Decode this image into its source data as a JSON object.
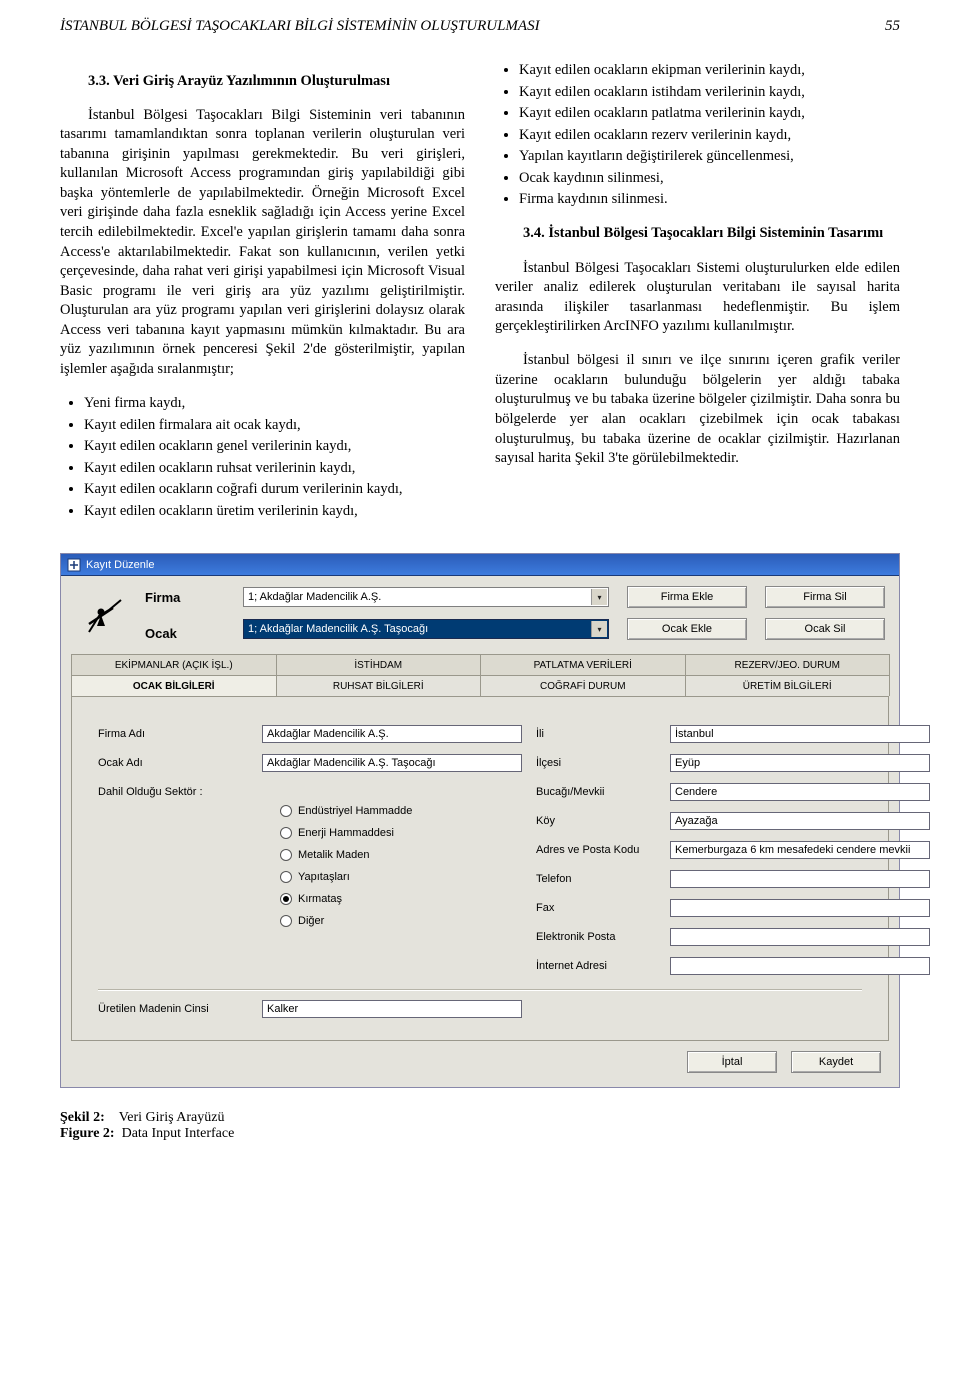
{
  "header": {
    "title": "İSTANBUL BÖLGESİ TAŞOCAKLARI BİLGİ SİSTEMİNİN OLUŞTURULMASI",
    "page_number": "55"
  },
  "left": {
    "heading": "3.3. Veri Giriş Arayüz Yazılımının Oluşturulması",
    "p1": "İstanbul Bölgesi Taşocakları Bilgi Sisteminin veri tabanının tasarımı tamamlandıktan sonra toplanan verilerin oluşturulan veri tabanına girişinin yapılması gerekmektedir. Bu veri girişleri, kullanılan Microsoft Access programından giriş yapılabildiği gibi başka yöntemlerle de yapılabilmektedir. Örneğin Microsoft Excel veri girişinde daha fazla esneklik sağladığı için Access yerine Excel tercih edilebilmektedir. Excel'e yapılan girişlerin tamamı daha sonra Access'e aktarılabilmektedir. Fakat son kullanıcının, verilen yetki çerçevesinde, daha rahat veri girişi yapabilmesi için Microsoft Visual Basic programı ile veri giriş ara yüz yazılımı geliştirilmiştir. Oluşturulan ara yüz programı yapılan veri girişlerini dolaysız olarak Access veri tabanına kayıt yapmasını mümkün kılmaktadır. Bu ara yüz yazılımının örnek penceresi Şekil 2'de gösterilmiştir, yapılan işlemler aşağıda sıralanmıştır;",
    "bullets": [
      "Yeni firma kaydı,",
      "Kayıt edilen firmalara ait ocak kaydı,",
      "Kayıt edilen ocakların genel verilerinin kaydı,",
      "Kayıt edilen ocakların ruhsat verilerinin kaydı,",
      "Kayıt edilen ocakların coğrafi durum verilerinin kaydı,",
      "Kayıt edilen ocakların üretim verilerinin kaydı,"
    ]
  },
  "right": {
    "bullets": [
      "Kayıt edilen ocakların ekipman verilerinin kaydı,",
      "Kayıt edilen ocakların istihdam verilerinin kaydı,",
      "Kayıt edilen ocakların patlatma verilerinin kaydı,",
      "Kayıt edilen ocakların rezerv verilerinin kaydı,",
      "Yapılan kayıtların değiştirilerek güncellenmesi,",
      "Ocak kaydının silinmesi,",
      "Firma kaydının silinmesi."
    ],
    "heading": "3.4. İstanbul Bölgesi Taşocakları Bilgi Sisteminin Tasarımı",
    "p1": "İstanbul Bölgesi Taşocakları Sistemi oluşturulurken elde edilen veriler analiz edilerek oluşturulan veritabanı ile sayısal harita arasında ilişkiler tasarlanması hedeflenmiştir. Bu işlem gerçekleştirilirken ArcINFO yazılımı kullanılmıştır.",
    "p2": "İstanbul bölgesi il sınırı ve ilçe sınırını içeren grafik veriler üzerine ocakların bulunduğu bölgelerin yer aldığı tabaka oluşturulmuş ve bu tabaka üzerine bölgeler çizilmiştir. Daha sonra bu bölgelerde yer alan ocakları çizebilmek için ocak tabakası oluşturulmuş, bu tabaka üzerine de ocaklar çizilmiştir. Hazırlanan sayısal harita Şekil 3'te görülebilmektedir."
  },
  "form": {
    "window_title": "Kayıt Düzenle",
    "label_firma": "Firma",
    "label_ocak": "Ocak",
    "combo_firma_value": "1; Akdağlar Madencilik A.Ş.",
    "combo_ocak_value": "1; Akdağlar Madencilik A.Ş. Taşocağı",
    "btn_firma_ekle": "Firma Ekle",
    "btn_firma_sil": "Firma Sil",
    "btn_ocak_ekle": "Ocak Ekle",
    "btn_ocak_sil": "Ocak Sil",
    "tabs_back": [
      "EKİPMANLAR (AÇIK İŞL.)",
      "İSTİHDAM",
      "PATLATMA VERİLERİ",
      "REZERV/JEO. DURUM"
    ],
    "tabs_front": [
      "OCAK BİLGİLERİ",
      "RUHSAT BİLGİLERİ",
      "COĞRAFİ DURUM",
      "ÜRETİM BİLGİLERİ"
    ],
    "fields_left": {
      "firma_adi_label": "Firma Adı",
      "firma_adi_value": "Akdağlar Madencilik A.Ş.",
      "ocak_adi_label": "Ocak Adı",
      "ocak_adi_value": "Akdağlar Madencilik A.Ş. Taşocağı",
      "sektor_label": "Dahil Olduğu Sektör :"
    },
    "sektor_options": [
      {
        "label": "Endüstriyel Hammadde",
        "checked": false
      },
      {
        "label": "Enerji Hammaddesi",
        "checked": false
      },
      {
        "label": "Metalik Maden",
        "checked": false
      },
      {
        "label": "Yapıtaşları",
        "checked": false
      },
      {
        "label": "Kırmataş",
        "checked": true
      },
      {
        "label": "Diğer",
        "checked": false
      }
    ],
    "uretilen_maden_label": "Üretilen Madenin Cinsi",
    "uretilen_maden_value": "Kalker",
    "fields_right": {
      "ili_label": "İli",
      "ili_value": "İstanbul",
      "ilcesi_label": "İlçesi",
      "ilcesi_value": "Eyüp",
      "bucak_label": "Bucağı/Mevkii",
      "bucak_value": "Cendere",
      "koy_label": "Köy",
      "koy_value": "Ayazağa",
      "adres_label": "Adres ve Posta Kodu",
      "adres_value": "Kemerburgaza 6 km mesafedeki cendere mevkii",
      "telefon_label": "Telefon",
      "telefon_value": "",
      "fax_label": "Fax",
      "fax_value": "",
      "eposta_label": "Elektronik Posta",
      "eposta_value": "",
      "internet_label": "İnternet Adresi",
      "internet_value": ""
    },
    "btn_iptal": "İptal",
    "btn_kaydet": "Kaydet"
  },
  "caption": {
    "sekil": "Şekil 2:",
    "sekil_text": "Veri Giriş Arayüzü",
    "figure": "Figure 2:",
    "figure_text": "Data Input Interface"
  }
}
